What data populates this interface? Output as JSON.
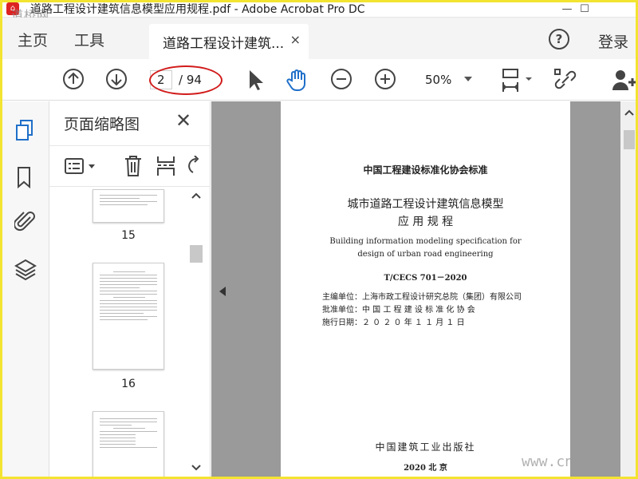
{
  "window": {
    "title": "道路工程设计建筑信息模型应用规程.pdf - Adobe Acrobat Pro DC",
    "watermark_top": "道桥网",
    "minimize": "—",
    "maximize": "☐"
  },
  "menu": {
    "home": "主页",
    "tools": "工具",
    "tab_label": "道路工程设计建筑...",
    "tab_close": "×",
    "help": "?",
    "login": "登录"
  },
  "toolbar": {
    "current_page": "2",
    "total_pages": "/ 94",
    "zoom": "50%"
  },
  "thumbnail_panel": {
    "title": "页面缩略图",
    "close": "✕",
    "pages": [
      {
        "label": "15"
      },
      {
        "label": "16"
      }
    ]
  },
  "document_page": {
    "header": "中国工程建设标准化协会标准",
    "title_line1": "城市道路工程设计建筑信息模型",
    "title_line2": "应 用 规 程",
    "en_line1": "Building information modeling specification for",
    "en_line2": "design of urban road engineering",
    "code": "T/CECS 701－2020",
    "editor_unit": "主编单位：上海市政工程设计研究总院（集团）有限公司",
    "approval_unit": "批准单位：中 国 工 程 建 设 标 准 化 协 会",
    "effective_date": "施行日期：２ ０ ２ ０ 年 １ １ 月 １ 日",
    "publisher": "中国建筑工业出版社",
    "pub_year_city": "2020   北   京"
  },
  "watermark_bottom": "www.cn"
}
